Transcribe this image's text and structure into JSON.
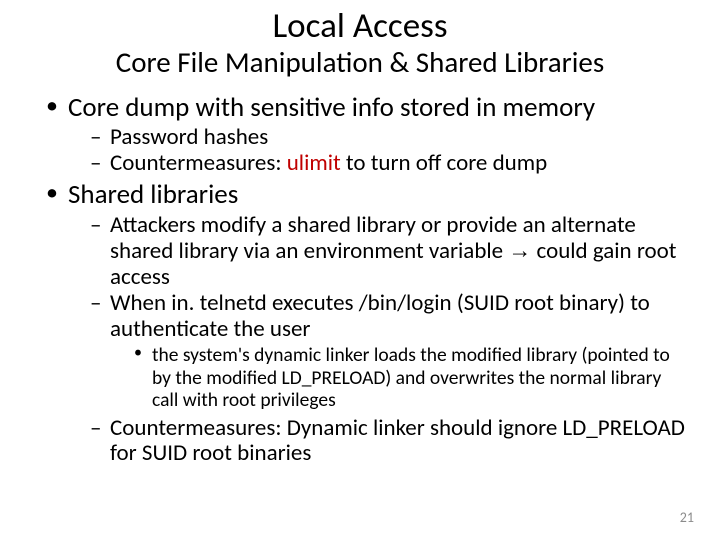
{
  "title": "Local Access",
  "subtitle": "Core File Manipulation & Shared Libraries",
  "bullets": {
    "b1": "Core dump with sensitive info stored in memory",
    "b1_1": "Password hashes",
    "b1_2a": "Countermeasures: ",
    "b1_2b": "ulimit",
    "b1_2c": " to turn off core dump",
    "b2": "Shared libraries",
    "b2_1a": "Attackers modify a shared library or provide an alternate shared library via an environment variable ",
    "b2_1arrow": "→",
    "b2_1b": " could gain root access",
    "b2_2a": "When in. telnetd executes /bin/login (SUID root binary) to authenticate the user",
    "b2_2_1": "the system's dynamic linker loads the modified library (pointed to by the modified LD_PRELOAD) and overwrites the normal library call with root privileges",
    "b2_3a": "Countermeasures: ",
    "b2_3b": "Dynamic linker should ignore LD_PRELOAD for SUID root binaries"
  },
  "page_number": "21"
}
